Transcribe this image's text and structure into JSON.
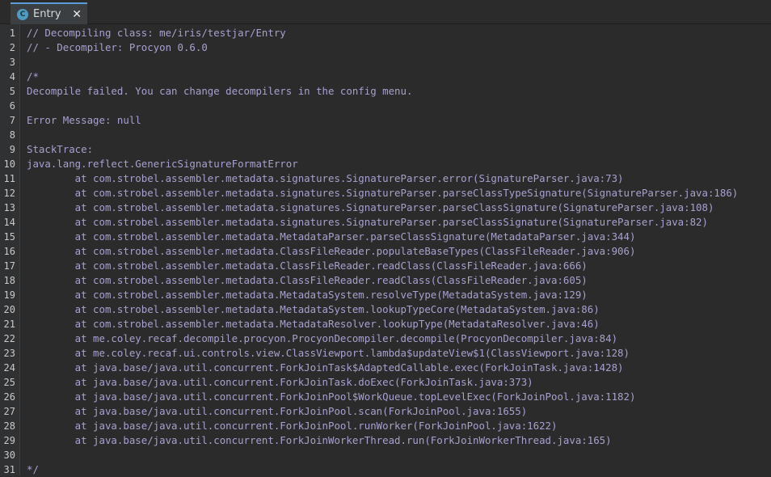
{
  "tab": {
    "icon": "C",
    "title": "Entry",
    "close_label": "✕"
  },
  "lines": [
    {
      "n": "1",
      "text": "// Decompiling class: me/iris/testjar/Entry"
    },
    {
      "n": "2",
      "text": "// - Decompiler: Procyon 0.6.0"
    },
    {
      "n": "3",
      "text": ""
    },
    {
      "n": "4",
      "text": "/*"
    },
    {
      "n": "5",
      "text": "Decompile failed. You can change decompilers in the config menu."
    },
    {
      "n": "6",
      "text": ""
    },
    {
      "n": "7",
      "text": "Error Message: null"
    },
    {
      "n": "8",
      "text": ""
    },
    {
      "n": "9",
      "text": "StackTrace:"
    },
    {
      "n": "10",
      "text": "java.lang.reflect.GenericSignatureFormatError"
    },
    {
      "n": "11",
      "text": "        at com.strobel.assembler.metadata.signatures.SignatureParser.error(SignatureParser.java:73)"
    },
    {
      "n": "12",
      "text": "        at com.strobel.assembler.metadata.signatures.SignatureParser.parseClassTypeSignature(SignatureParser.java:186)"
    },
    {
      "n": "13",
      "text": "        at com.strobel.assembler.metadata.signatures.SignatureParser.parseClassSignature(SignatureParser.java:108)"
    },
    {
      "n": "14",
      "text": "        at com.strobel.assembler.metadata.signatures.SignatureParser.parseClassSignature(SignatureParser.java:82)"
    },
    {
      "n": "15",
      "text": "        at com.strobel.assembler.metadata.MetadataParser.parseClassSignature(MetadataParser.java:344)"
    },
    {
      "n": "16",
      "text": "        at com.strobel.assembler.metadata.ClassFileReader.populateBaseTypes(ClassFileReader.java:906)"
    },
    {
      "n": "17",
      "text": "        at com.strobel.assembler.metadata.ClassFileReader.readClass(ClassFileReader.java:666)"
    },
    {
      "n": "18",
      "text": "        at com.strobel.assembler.metadata.ClassFileReader.readClass(ClassFileReader.java:605)"
    },
    {
      "n": "19",
      "text": "        at com.strobel.assembler.metadata.MetadataSystem.resolveType(MetadataSystem.java:129)"
    },
    {
      "n": "20",
      "text": "        at com.strobel.assembler.metadata.MetadataSystem.lookupTypeCore(MetadataSystem.java:86)"
    },
    {
      "n": "21",
      "text": "        at com.strobel.assembler.metadata.MetadataResolver.lookupType(MetadataResolver.java:46)"
    },
    {
      "n": "22",
      "text": "        at me.coley.recaf.decompile.procyon.ProcyonDecompiler.decompile(ProcyonDecompiler.java:84)"
    },
    {
      "n": "23",
      "text": "        at me.coley.recaf.ui.controls.view.ClassViewport.lambda$updateView$1(ClassViewport.java:128)"
    },
    {
      "n": "24",
      "text": "        at java.base/java.util.concurrent.ForkJoinTask$AdaptedCallable.exec(ForkJoinTask.java:1428)"
    },
    {
      "n": "25",
      "text": "        at java.base/java.util.concurrent.ForkJoinTask.doExec(ForkJoinTask.java:373)"
    },
    {
      "n": "26",
      "text": "        at java.base/java.util.concurrent.ForkJoinPool$WorkQueue.topLevelExec(ForkJoinPool.java:1182)"
    },
    {
      "n": "27",
      "text": "        at java.base/java.util.concurrent.ForkJoinPool.scan(ForkJoinPool.java:1655)"
    },
    {
      "n": "28",
      "text": "        at java.base/java.util.concurrent.ForkJoinPool.runWorker(ForkJoinPool.java:1622)"
    },
    {
      "n": "29",
      "text": "        at java.base/java.util.concurrent.ForkJoinWorkerThread.run(ForkJoinWorkerThread.java:165)"
    },
    {
      "n": "30",
      "text": ""
    },
    {
      "n": "31",
      "text": "*/"
    }
  ]
}
